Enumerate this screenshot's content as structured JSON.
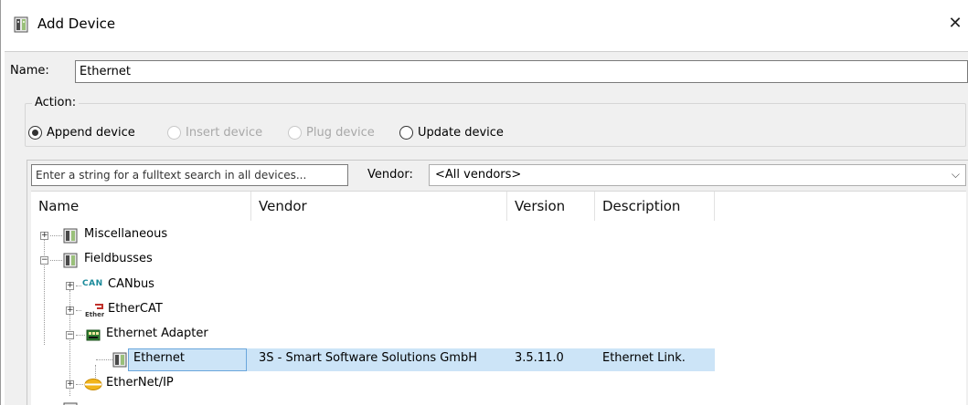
{
  "window": {
    "title": "Add Device",
    "close_glyph": "✕"
  },
  "name_field": {
    "label": "Name:",
    "value": "Ethernet"
  },
  "action": {
    "label": "Action:",
    "options": [
      {
        "label": "Append device",
        "checked": true,
        "enabled": true
      },
      {
        "label": "Insert device",
        "checked": false,
        "enabled": false
      },
      {
        "label": "Plug device",
        "checked": false,
        "enabled": false
      },
      {
        "label": "Update device",
        "checked": false,
        "enabled": true
      }
    ]
  },
  "search": {
    "placeholder": "Enter a string for a fulltext search in all devices...",
    "vendor_label": "Vendor:",
    "vendor_value": "<All vendors>"
  },
  "table": {
    "columns": [
      "Name",
      "Vendor",
      "Version",
      "Description"
    ],
    "rows": [
      {
        "name": "Miscellaneous",
        "vendor": "",
        "version": "",
        "description": "",
        "icon": "device-icon",
        "expander": "+"
      },
      {
        "name": "Fieldbusses",
        "vendor": "",
        "version": "",
        "description": "",
        "icon": "device-icon",
        "expander": "−"
      },
      {
        "name": "CANbus",
        "vendor": "",
        "version": "",
        "description": "",
        "icon": "can-icon",
        "icon_text": "CAN",
        "expander": "+"
      },
      {
        "name": "EtherCAT",
        "vendor": "",
        "version": "",
        "description": "",
        "icon": "ethercat-icon",
        "expander": "+"
      },
      {
        "name": "Ethernet Adapter",
        "vendor": "",
        "version": "",
        "description": "",
        "icon": "ethernet-adapter-icon",
        "expander": "−"
      },
      {
        "name": "Ethernet",
        "vendor": "3S - Smart Software Solutions GmbH",
        "version": "3.5.11.0",
        "description": "Ethernet Link.",
        "icon": "device-icon",
        "selected": true
      },
      {
        "name": "EtherNet/IP",
        "vendor": "",
        "version": "",
        "description": "",
        "icon": "ethernetip-icon",
        "expander": "+"
      }
    ]
  },
  "colors": {
    "selection": "#cce4f7",
    "selection_border": "#6aa6dc",
    "can_teal": "#1a8a9a",
    "ethernetip_yellow": "#f2b51c"
  }
}
